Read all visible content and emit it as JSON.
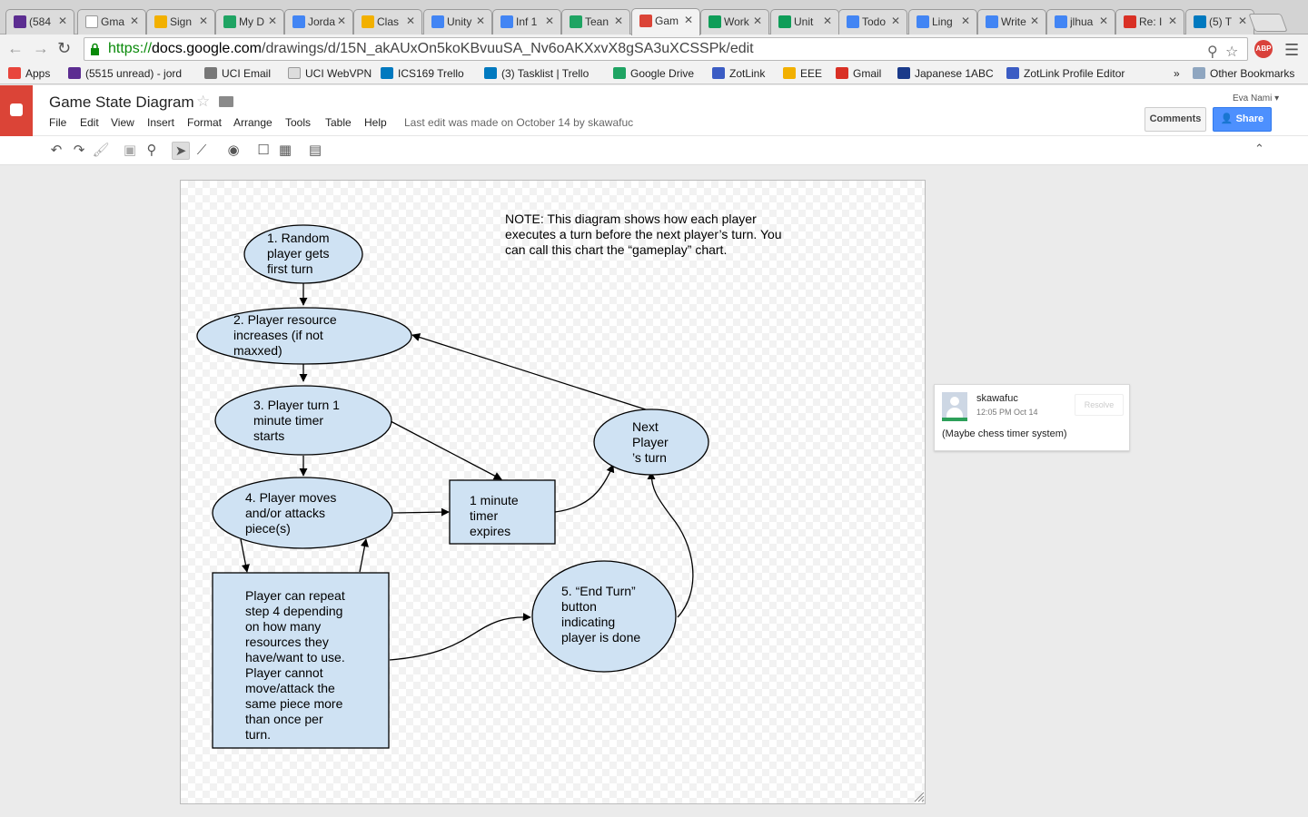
{
  "browser": {
    "tabs": [
      {
        "label": "(584",
        "color": "#5c2d91"
      },
      {
        "label": "Gma",
        "color": "#ffffff"
      },
      {
        "label": "Sign",
        "color": "#f2b000"
      },
      {
        "label": "My D",
        "color": "#1fa463"
      },
      {
        "label": "Jorda",
        "color": "#4285f4"
      },
      {
        "label": "Clas",
        "color": "#f2b000"
      },
      {
        "label": "Unity",
        "color": "#4285f4"
      },
      {
        "label": "Inf 1",
        "color": "#4285f4"
      },
      {
        "label": "Tean",
        "color": "#1fa463"
      },
      {
        "label": "Gam",
        "color": "#db4437"
      },
      {
        "label": "Work",
        "color": "#0f9d58"
      },
      {
        "label": "Unit",
        "color": "#0f9d58"
      },
      {
        "label": "Todo",
        "color": "#4285f4"
      },
      {
        "label": "Ling",
        "color": "#4285f4"
      },
      {
        "label": "Write",
        "color": "#4285f4"
      },
      {
        "label": "jlhua",
        "color": "#4285f4"
      },
      {
        "label": "Re: I",
        "color": "#d93025"
      },
      {
        "label": "(5) T",
        "color": "#0079bf"
      }
    ],
    "active_tab_index": 9,
    "url_scheme": "https://",
    "url_host": "docs.google.com",
    "url_path": "/drawings/d/15N_akAUxOn5koKBvuuSA_Nv6oAKXxvX8gSA3uXCSSPk/edit",
    "adblock_label": "ABP"
  },
  "bookmarks": [
    {
      "label": "Apps",
      "color": "#e8453c"
    },
    {
      "label": "(5515 unread) - jord",
      "color": "#5c2d91"
    },
    {
      "label": "UCI Email",
      "color": "#777777"
    },
    {
      "label": "UCI WebVPN",
      "color": "#dddddd"
    },
    {
      "label": "ICS169 Trello",
      "color": "#0079bf"
    },
    {
      "label": "(3) Tasklist | Trello",
      "color": "#0079bf"
    },
    {
      "label": "Google Drive",
      "color": "#1fa463"
    },
    {
      "label": "ZotLink",
      "color": "#3b5cc4"
    },
    {
      "label": "EEE",
      "color": "#f2b000"
    },
    {
      "label": "Gmail",
      "color": "#d93025"
    },
    {
      "label": "Japanese 1ABC",
      "color": "#1a3a8a"
    },
    {
      "label": "ZotLink Profile Editor",
      "color": "#3b5cc4"
    }
  ],
  "bookmarks_more": "»",
  "other_bookmarks": "Other Bookmarks",
  "docs": {
    "title": "Game State Diagram",
    "menu": [
      "File",
      "Edit",
      "View",
      "Insert",
      "Format",
      "Arrange",
      "Tools",
      "Table",
      "Help"
    ],
    "last_edit": "Last edit was made on October 14 by skawafuc",
    "user": "Eva Nami",
    "comments_label": "Comments",
    "share_label": "Share"
  },
  "diagram": {
    "note": "NOTE:  This diagram shows how each player\nexecutes a turn before the next player’s turn.  You\ncan call this chart the “gameplay” chart.",
    "nodes": {
      "n1": "1. Random\nplayer gets\nfirst turn",
      "n2": "2. Player resource\nincreases (if not\nmaxxed)",
      "n3": "3.     Player turn 1\n        minute timer\n        starts",
      "n4": "4. Player moves\nand/or attacks\npiece(s)",
      "n5": "Player can repeat\nstep 4 depending\non how many\nresources they\nhave/want to use.\nPlayer cannot\nmove/attack the\nsame piece more\nthan once per\nturn.",
      "n6": "1 minute\ntimer\nexpires",
      "n7": "Next\nPlayer\n’s turn",
      "n8": "5. “End Turn”\nbutton\nindicating\nplayer is done"
    },
    "fill_color": "#cfe2f3"
  },
  "comment": {
    "author": "skawafuc",
    "time": "12:05 PM Oct 14",
    "resolve_label": "Resolve",
    "body": "(Maybe chess timer system)"
  }
}
